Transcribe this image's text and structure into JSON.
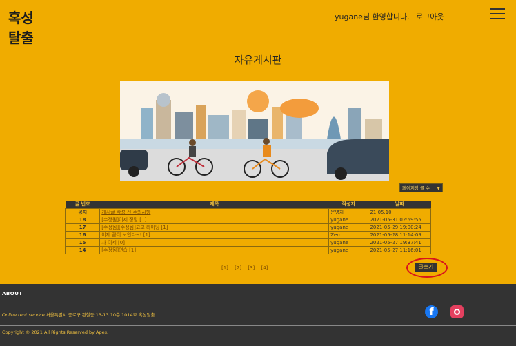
{
  "header": {
    "logo_line1": "혹성",
    "logo_line2": "탈출",
    "welcome": "yugane님 환영합니다.",
    "logout": "로그아웃"
  },
  "board": {
    "title": "자유게시판",
    "sort_label": "페이지당 글 수",
    "columns": [
      "글 번호",
      "제목",
      "작성자",
      "날짜"
    ],
    "rows": [
      {
        "num": "공지",
        "title": "게시글 작성 전 주의사항",
        "writer": "운영자",
        "date": "21.05.10"
      },
      {
        "num": "18",
        "title": "[수정됨]이제 정말  [1]",
        "writer": "yugane",
        "date": "2021-05-31 02:59:55"
      },
      {
        "num": "17",
        "title": "[수정됨][수정됨]고고 라이딩  [1]",
        "writer": "yugane",
        "date": "2021-05-29 19:00:24"
      },
      {
        "num": "16",
        "title": "이제 끝이 보인다~!  [1]",
        "writer": "Zero",
        "date": "2021-05-28 11:14:09"
      },
      {
        "num": "15",
        "title": "자 이제  [0]",
        "writer": "yugane",
        "date": "2021-05-27 19:37:41"
      },
      {
        "num": "14",
        "title": "[수정됨]연습  [1]",
        "writer": "yugane",
        "date": "2021-05-27 11:16:01"
      }
    ],
    "pages": [
      "[1]",
      "[2]",
      "[3]",
      "[4]"
    ],
    "write_button": "글쓰기"
  },
  "footer": {
    "about": "ABOUT",
    "service": "Online rent service",
    "address": " 서울특별시 종로구 관철동 13-13 10층 1014호 혹성탈출",
    "copyright": "Copyright © 2021 All Rights Reserved by Apes."
  },
  "colors": {
    "background": "#f0ac00",
    "dark": "#333333",
    "accent": "#f0c040",
    "highlight_ring": "#d8141c"
  },
  "icons": [
    "hamburger-menu-icon",
    "facebook-icon",
    "instagram-icon"
  ]
}
